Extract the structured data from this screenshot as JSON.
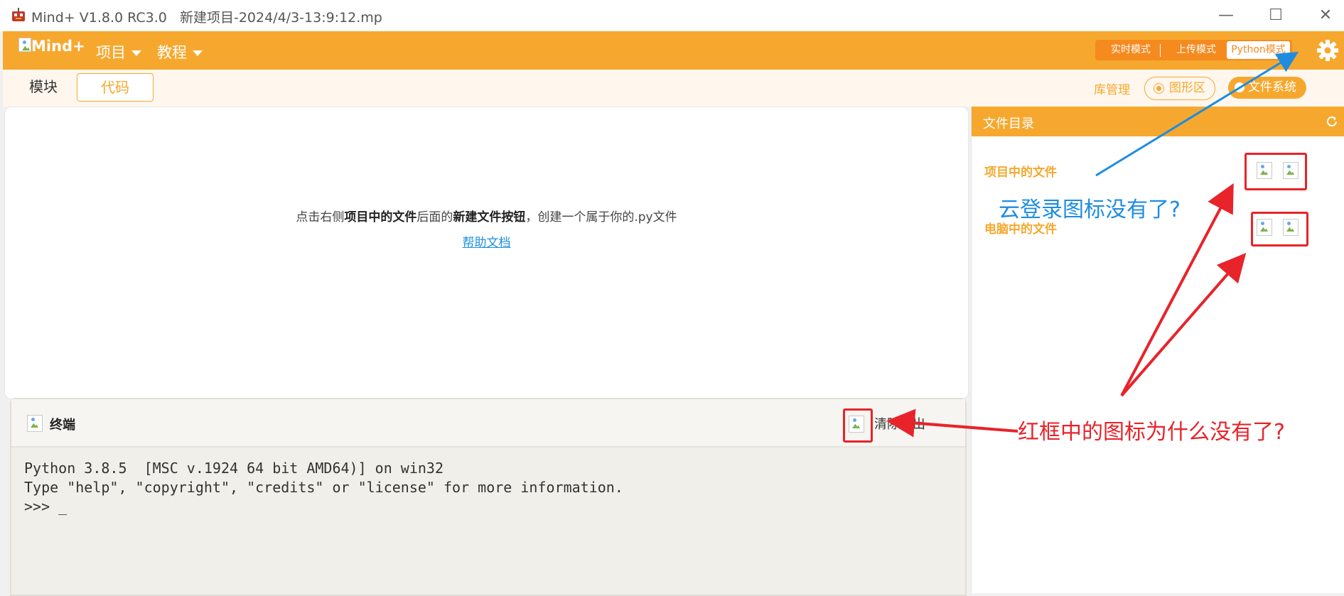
{
  "window": {
    "title": "Mind+ V1.8.0 RC3.0   新建项目-2024/4/3-13:9:12.mp",
    "minimize_glyph": "—",
    "maximize_glyph": "☐",
    "close_glyph": "✕"
  },
  "header": {
    "logo_alt": "Mind+",
    "menu": [
      {
        "label": "项目"
      },
      {
        "label": "教程"
      }
    ],
    "modes": [
      {
        "label": "实时模式",
        "active": false
      },
      {
        "label": "上传模式",
        "active": false
      },
      {
        "label": "Python模式",
        "active": true
      }
    ],
    "settings_icon": "gear-icon"
  },
  "tabs": {
    "blocks": "模块",
    "code": "代码",
    "library": "库管理",
    "graphics_area": "图形区",
    "file_system": "文件系统"
  },
  "editor": {
    "hint_parts": [
      "点击右侧",
      "项目中的文件",
      "后面的",
      "新建文件按钮",
      "，创建一个属于你的.py文件"
    ],
    "help_link": "帮助文档"
  },
  "terminal": {
    "title": "终端",
    "clear_label": "清除输出",
    "lines": [
      "Python 3.8.5  [MSC v.1924 64 bit AMD64)] on win32",
      "Type \"help\", \"copyright\", \"credits\" or \"license\" for more information.",
      ">>> _"
    ]
  },
  "file_panel": {
    "title": "文件目录",
    "project_files": "项目中的文件",
    "computer_files": "电脑中的文件",
    "refresh_icon": "refresh-icon"
  },
  "annotations": {
    "blue_note": "云登录图标没有了?",
    "red_note": "红框中的图标为什么没有了?"
  },
  "colors": {
    "brand_orange": "#f6a82e",
    "mode_orange": "#f58a1f",
    "annotation_red": "#e8232a",
    "annotation_blue": "#1e8de0",
    "link_blue": "#1e90e0"
  }
}
